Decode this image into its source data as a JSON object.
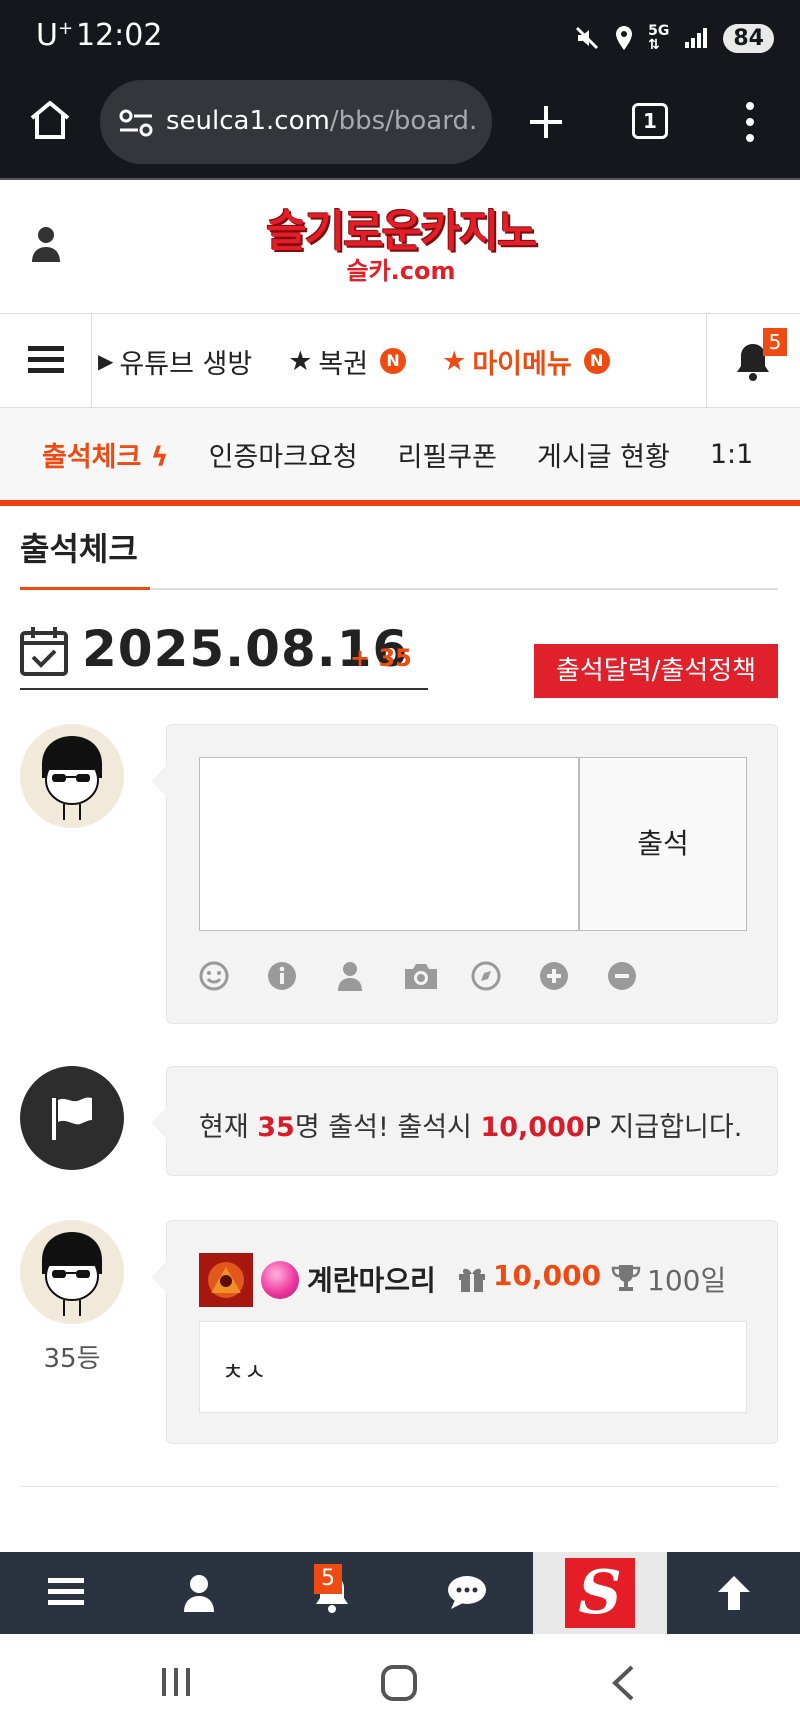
{
  "status_bar": {
    "carrier": "U",
    "carrier_sup": "+",
    "time": "12:02",
    "network": "5G",
    "battery": "84"
  },
  "browser": {
    "url_host": "seulca1.com",
    "url_path": "/bbs/board.pl",
    "tab_count": "1"
  },
  "site": {
    "logo_main": "슬기로운카지노",
    "logo_sub": "슬카.com"
  },
  "main_nav": {
    "items": [
      {
        "label": "유튜브 생방",
        "prefix": "▶",
        "new": false
      },
      {
        "label": "복권",
        "prefix": "★",
        "new": true
      },
      {
        "label": "마이메뉴",
        "prefix": "★",
        "new": true
      }
    ],
    "new_badge": "N",
    "notification_count": "5"
  },
  "sub_nav": {
    "items": [
      "출석체크",
      "인증마크요청",
      "리필쿠폰",
      "게시글 현황",
      "1:1"
    ]
  },
  "page": {
    "title": "출석체크",
    "date": "2025.08.16",
    "date_extra": "+ 35",
    "calendar_button": "출석달력/출석정책"
  },
  "input_card": {
    "submit_label": "출석",
    "tools": [
      "smile-icon",
      "info-icon",
      "user-icon",
      "camera-icon",
      "compass-icon",
      "plus-circle-icon",
      "minus-circle-icon"
    ]
  },
  "info": {
    "prefix": "현재 ",
    "count": "35",
    "mid": "명 출석! 출석시 ",
    "reward": "10,000",
    "suffix": "P 지급합니다."
  },
  "entries": [
    {
      "rank": "35등",
      "nickname": "계란마으리",
      "points": "10,000",
      "streak": "100일",
      "message": "ㅊㅅ"
    }
  ],
  "bottom_bar": {
    "notification_count": "5",
    "logo_letter": "S"
  },
  "colors": {
    "accent": "#ed4b12",
    "red": "#e0202a",
    "dark": "#16171c",
    "bottom_bar": "#2c3340"
  }
}
